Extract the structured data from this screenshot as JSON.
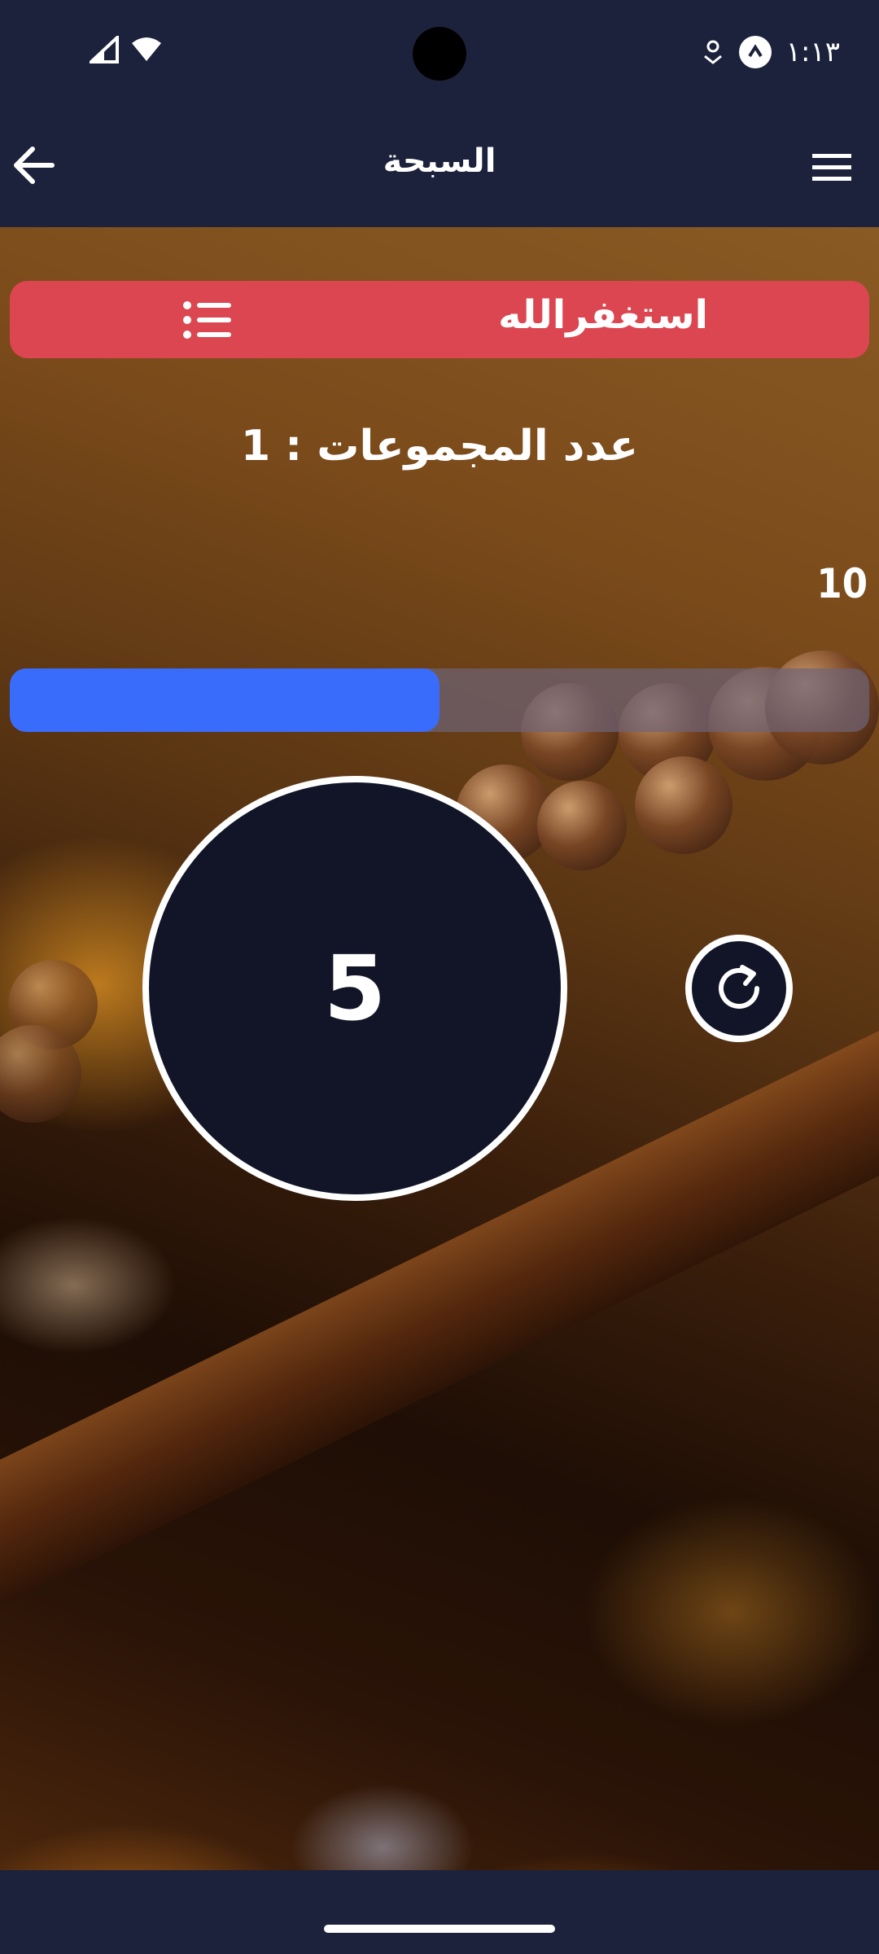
{
  "status_bar": {
    "time": "١:١٣",
    "icons": [
      "signal-icon",
      "wifi-icon",
      "location-icon",
      "app-notification-icon"
    ]
  },
  "app_bar": {
    "title": "السبحة",
    "back_icon": "arrow-left-icon",
    "menu_icon": "hamburger-menu-icon"
  },
  "dhikr": {
    "text": "استغفرالله",
    "list_icon": "list-icon"
  },
  "groups": {
    "label": "عدد المجموعات : 1"
  },
  "target": "10",
  "progress": {
    "fraction": 0.5
  },
  "counter": {
    "value": "5"
  },
  "reset_icon": "refresh-icon",
  "colors": {
    "bar_bg": "#1c223b",
    "dhikr_bar": "#dc4650",
    "progress_fill": "#3a6cfb",
    "counter_bg": "#111527"
  }
}
